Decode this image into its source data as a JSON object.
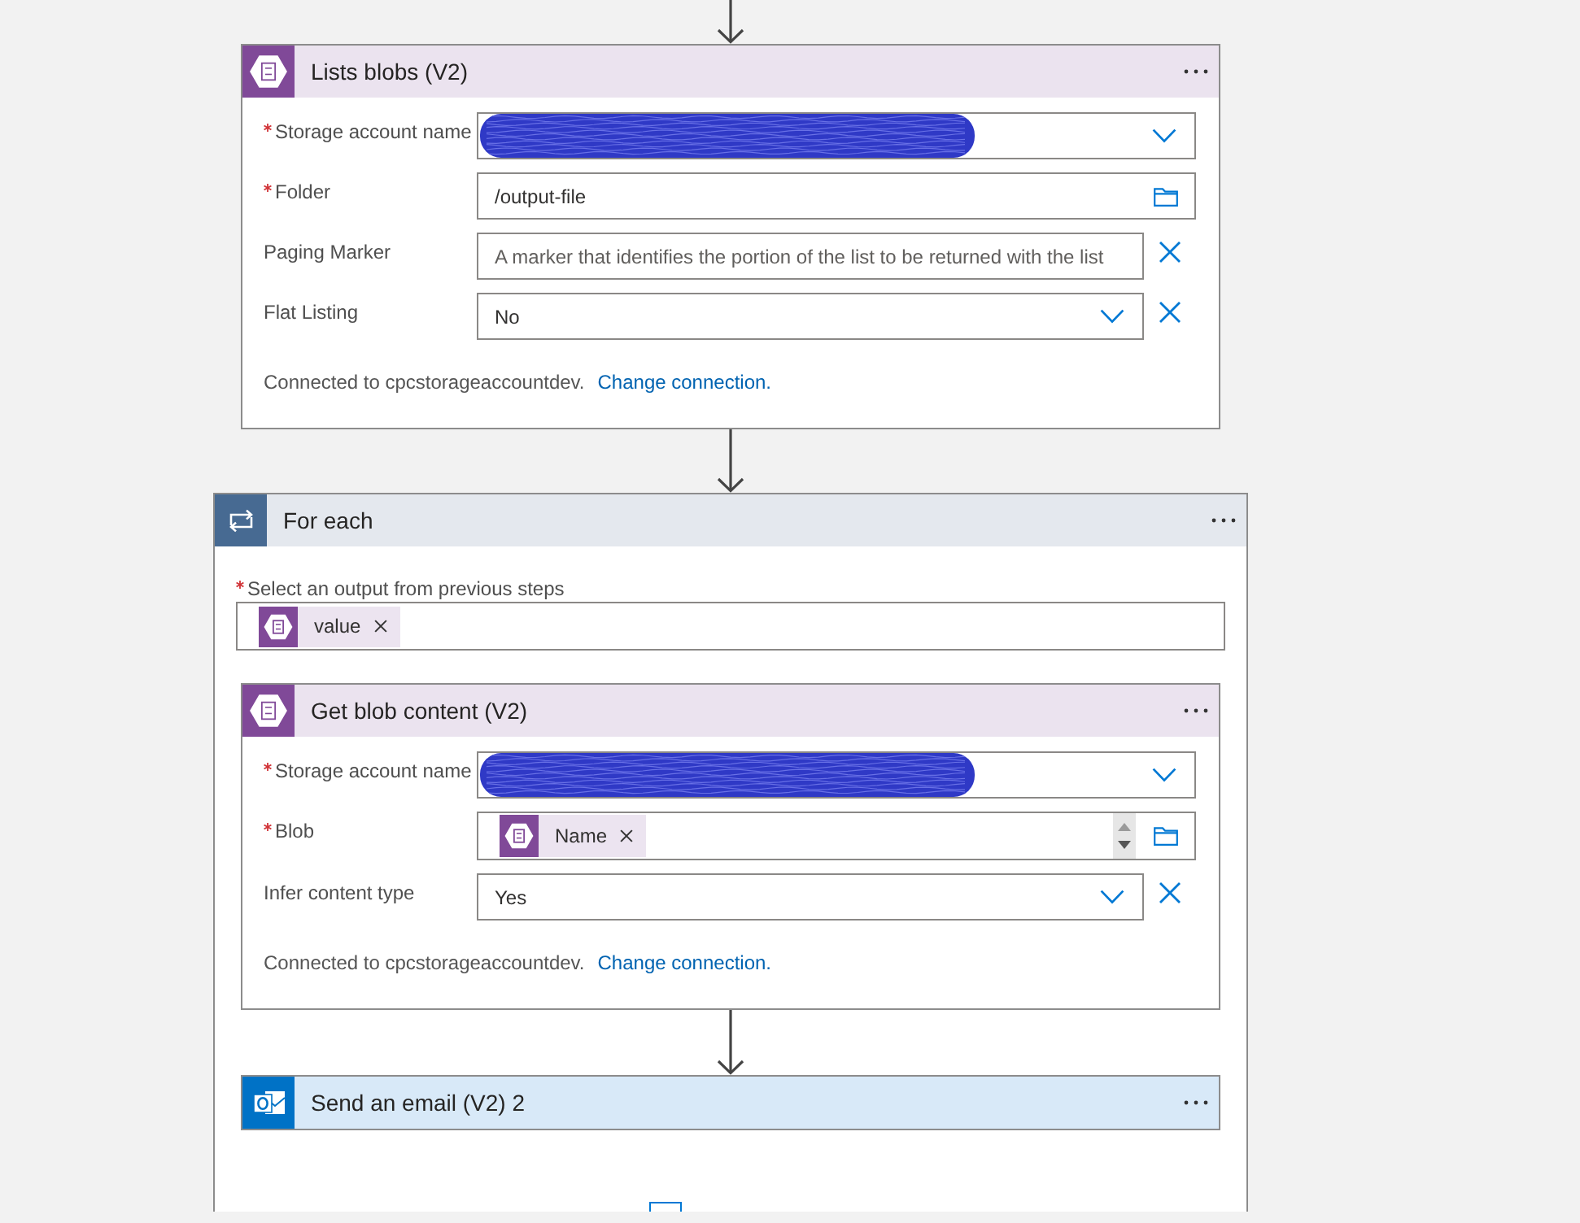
{
  "flow": {
    "steps": [
      {
        "kind": "blob",
        "title": "Lists blobs (V2)",
        "expanded": true,
        "fields": [
          {
            "kind": "dropdown",
            "label": "Storage account name",
            "required": true,
            "redacted": true,
            "removable": false
          },
          {
            "kind": "text",
            "label": "Folder",
            "required": true,
            "value": "/output-file",
            "picker": true,
            "removable": false
          },
          {
            "kind": "text",
            "label": "Paging Marker",
            "required": false,
            "placeholder": "A marker that identifies the portion of the list to be returned with the list",
            "removable": true
          },
          {
            "kind": "dropdown",
            "label": "Flat Listing",
            "required": false,
            "value": "No",
            "removable": true
          }
        ],
        "connection": {
          "text": "Connected to cpcstorageaccountdev.",
          "link": "Change connection."
        }
      },
      {
        "kind": "foreach",
        "title": "For each",
        "input": {
          "label": "Select an output from previous steps",
          "required": true,
          "tokens": [
            {
              "kind": "blob",
              "label": "value"
            }
          ]
        },
        "steps": [
          {
            "kind": "blob",
            "title": "Get blob content (V2)",
            "expanded": true,
            "fields": [
              {
                "kind": "dropdown",
                "label": "Storage account name",
                "required": true,
                "redacted": true,
                "removable": false
              },
              {
                "kind": "token",
                "label": "Blob",
                "required": true,
                "tokens": [
                  {
                    "kind": "blob",
                    "label": "Name"
                  }
                ],
                "picker": true,
                "stepper": true,
                "removable": false
              },
              {
                "kind": "dropdown",
                "label": "Infer content type",
                "required": false,
                "value": "Yes",
                "removable": true
              }
            ],
            "connection": {
              "text": "Connected to cpcstorageaccountdev.",
              "link": "Change connection."
            }
          },
          {
            "kind": "email",
            "title": "Send an email (V2) 2",
            "expanded": false
          }
        ]
      }
    ]
  }
}
